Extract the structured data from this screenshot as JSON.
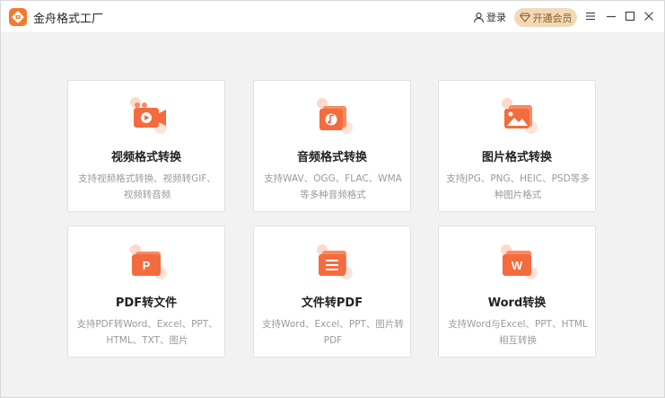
{
  "app": {
    "title": "金舟格式工厂",
    "login_label": "登录",
    "vip_label": "开通会员",
    "accent_color": "#f47a2a",
    "vip_color": "#f1d9b8"
  },
  "window_controls": [
    "menu-icon",
    "minimize-icon",
    "maximize-icon",
    "close-icon"
  ],
  "cards": [
    {
      "title": "视频格式转换",
      "desc": "支持视频格式转换、视频转GIF、视频转音频",
      "icon": "video-icon"
    },
    {
      "title": "音频格式转换",
      "desc": "支持WAV、OGG、FLAC、WMA等多种音频格式",
      "icon": "audio-icon"
    },
    {
      "title": "图片格式转换",
      "desc": "支持JPG、PNG、HEIC、PSD等多种图片格式",
      "icon": "image-icon"
    },
    {
      "title": "PDF转文件",
      "desc": "支持PDF转Word、Excel、PPT、HTML、TXT、图片",
      "icon": "pdf-icon"
    },
    {
      "title": "文件转PDF",
      "desc": "支持Word、Excel、PPT、图片转PDF",
      "icon": "file-to-pdf-icon"
    },
    {
      "title": "Word转换",
      "desc": "支持Word与Excel、PPT、HTML相互转换",
      "icon": "word-icon"
    }
  ]
}
